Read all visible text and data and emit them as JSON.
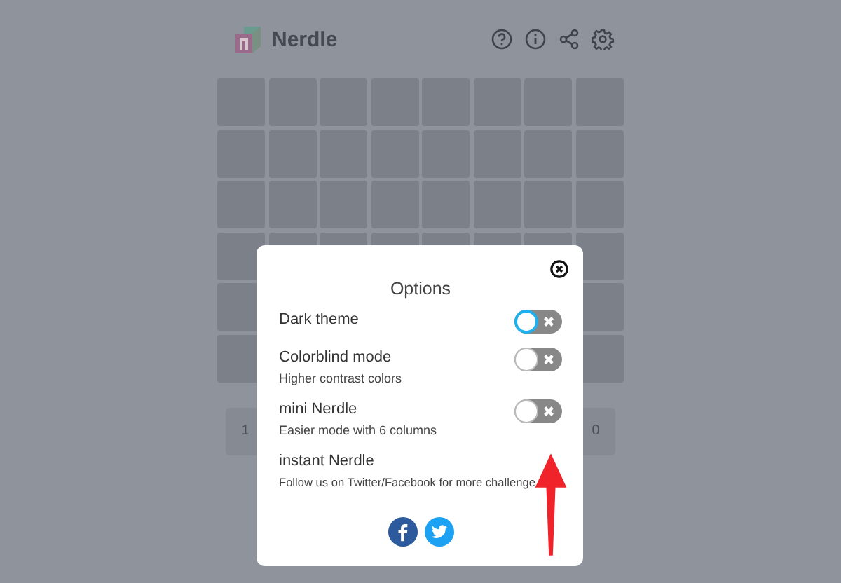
{
  "header": {
    "title": "Nerdle"
  },
  "keyboard": {
    "keys": [
      "1",
      "0"
    ]
  },
  "dialog": {
    "title": "Options",
    "options": [
      {
        "label": "Dark theme",
        "on": false,
        "focused": true
      },
      {
        "label": "Colorblind mode",
        "description": "Higher contrast colors",
        "on": false,
        "focused": false
      },
      {
        "label": "mini Nerdle",
        "description": "Easier mode with 6 columns",
        "on": false,
        "focused": false
      }
    ],
    "footer": {
      "label": "instant Nerdle",
      "description": "Follow us on Twitter/Facebook for more challenge"
    }
  }
}
